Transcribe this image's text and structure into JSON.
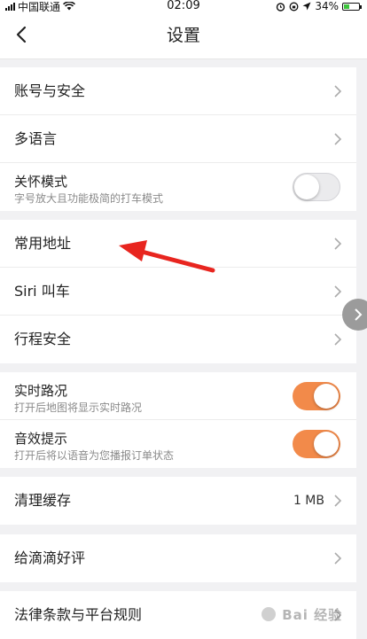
{
  "status_bar": {
    "carrier": "中国联通",
    "time": "02:09",
    "battery": "34%"
  },
  "nav": {
    "title": "设置",
    "back_icon": "chevron-left-icon"
  },
  "groups": [
    {
      "rows": [
        {
          "label": "账号与安全",
          "type": "link"
        },
        {
          "label": "多语言",
          "type": "link"
        },
        {
          "label": "关怀模式",
          "sub": "字号放大且功能极简的打车模式",
          "type": "toggle",
          "on": false
        }
      ]
    },
    {
      "rows": [
        {
          "label": "常用地址",
          "type": "link"
        },
        {
          "label": "Siri 叫车",
          "type": "link"
        },
        {
          "label": "行程安全",
          "type": "link"
        }
      ]
    },
    {
      "rows": [
        {
          "label": "实时路况",
          "sub": "打开后地图将显示实时路况",
          "type": "toggle",
          "on": true
        },
        {
          "label": "音效提示",
          "sub": "打开后将以语音为您播报订单状态",
          "type": "toggle",
          "on": true
        }
      ]
    },
    {
      "rows": [
        {
          "label": "清理缓存",
          "value": "1 MB",
          "type": "link"
        }
      ]
    },
    {
      "rows": [
        {
          "label": "给滴滴好评",
          "type": "link"
        }
      ]
    },
    {
      "rows": [
        {
          "label": "法律条款与平台规则",
          "type": "link"
        }
      ]
    }
  ],
  "colors": {
    "toggle_on": "#f28a4a",
    "annotation_arrow": "#e8251f",
    "background": "#f1f1f3"
  },
  "watermark": "Bai 经验"
}
